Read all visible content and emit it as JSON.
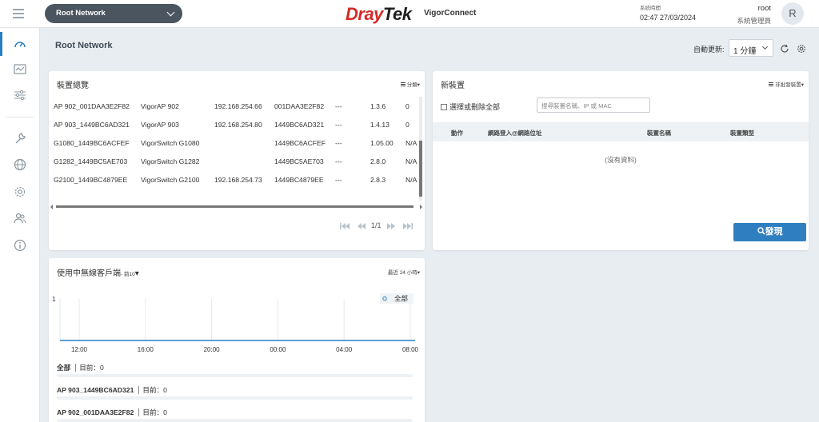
{
  "header": {
    "network_selector": "Root Network",
    "brand_red": "Dray",
    "brand_dark": "Tek",
    "app_name": "VigorConnect",
    "system_time_label": "系統時間",
    "system_time": "02:47 27/03/2024",
    "user_name": "root",
    "user_role": "系統管理員",
    "avatar_initial": "R"
  },
  "sidebar": {
    "items": [
      "dashboard-icon",
      "monitor-icon",
      "sliders-icon",
      "wrench-icon",
      "globe-icon",
      "gear-icon",
      "users-icon",
      "info-icon"
    ],
    "active_index": 0,
    "accent": "#2a7fc0"
  },
  "page": {
    "title": "Root Network",
    "auto_refresh_label": "自動更新:",
    "auto_refresh_value": "1 分鐘"
  },
  "overview": {
    "title": "裝置總覽",
    "group_label": "分類",
    "rows": [
      [
        "AP 902_001DAA3E2F82",
        "VigorAP 902",
        "192.168.254.66",
        "001DAA3E2F82",
        "---",
        "1.3.6",
        "0"
      ],
      [
        "AP 903_1449BC6AD321",
        "VigorAP 903",
        "192.168.254.80",
        "1449BC6AD321",
        "---",
        "1.4.13",
        "0"
      ],
      [
        "G1080_1449BC6ACFEF",
        "VigorSwitch G1080",
        "",
        "1449BC6ACFEF",
        "---",
        "1.05.00",
        "N/A"
      ],
      [
        "G1282_1449BC5AE703",
        "VigorSwitch G1282",
        "",
        "1449BC5AE703",
        "---",
        "2.8.0",
        "N/A"
      ],
      [
        "G2100_1449BC4879EE",
        "VigorSwitch G2100",
        "192.168.254.73",
        "1449BC4879EE",
        "---",
        "2.8.3",
        "N/A"
      ]
    ],
    "page_info": "1/1"
  },
  "new_devices": {
    "title": "新裝置",
    "sort_label": "非批發裝置",
    "select_all_label": "選擇或刪除全部",
    "search_placeholder": "搜尋裝置名稱、IP 或 MAC",
    "columns": [
      "動作",
      "網路登入@網路位址",
      "裝置名稱",
      "裝置類型"
    ],
    "no_data": "(沒有資料)",
    "discover_label": "發現"
  },
  "wireless": {
    "title": "使用中無線客戶端",
    "title_suffix": "- 前10",
    "range_label": "最近 24 小時",
    "legend": "全部",
    "y_max_label": "1",
    "series": [
      {
        "name": "全部",
        "current_label": "目前：0"
      },
      {
        "name": "AP 903_1449BC6AD321",
        "current_label": "目前：0"
      },
      {
        "name": "AP 902_001DAA3E2F82",
        "current_label": "目前：0"
      }
    ]
  },
  "chart_data": {
    "type": "line",
    "x": [
      "12:00",
      "16:00",
      "20:00",
      "00:00",
      "04:00",
      "08:00"
    ],
    "series": [
      {
        "name": "全部",
        "values": [
          0,
          0,
          0,
          0,
          0,
          0
        ]
      }
    ],
    "ylim": [
      0,
      1
    ],
    "legend_position": "top-right",
    "grid": true
  }
}
